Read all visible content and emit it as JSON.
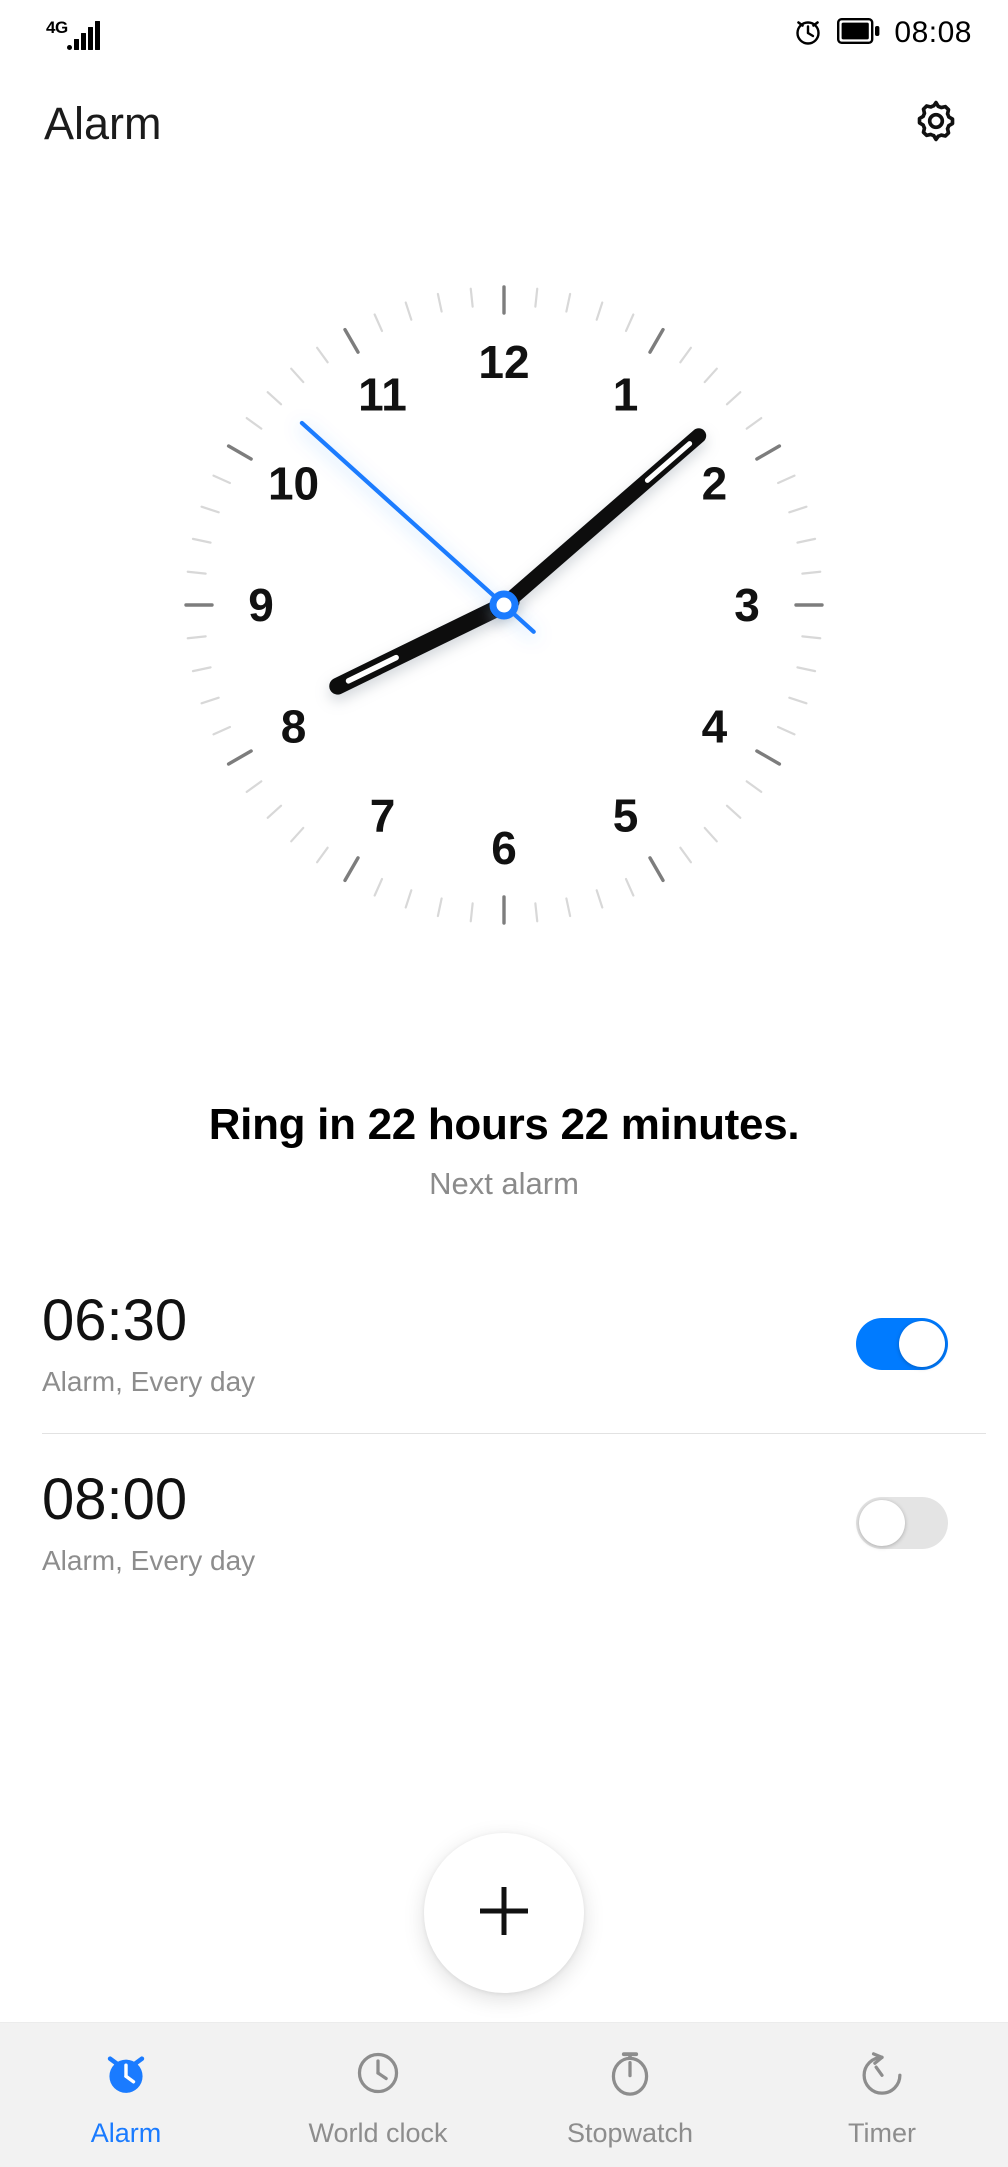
{
  "status_bar": {
    "network_label": "4G",
    "signal_icon": "signal-bars-icon",
    "alarm_icon": "alarm-clock-icon",
    "battery_icon": "battery-full-icon",
    "time": "08:08"
  },
  "app_bar": {
    "title": "Alarm",
    "settings_icon": "gear-icon"
  },
  "clock": {
    "numerals": [
      "1",
      "2",
      "3",
      "4",
      "5",
      "6",
      "7",
      "8",
      "9",
      "10",
      "11",
      "12"
    ],
    "hour_hand_angle": 244,
    "minute_hand_angle": 49,
    "second_hand_angle": 312,
    "hand_color": "#111111",
    "second_hand_color": "#1a7bff",
    "tick_color_minor": "#d8d8d8",
    "tick_color_major": "#7d7d7d",
    "numeral_color": "#111111"
  },
  "next_alarm": {
    "headline": "Ring in 22 hours 22 minutes.",
    "subtitle": "Next alarm"
  },
  "alarms": [
    {
      "time": "06:30",
      "description": "Alarm, Every day",
      "enabled": true,
      "toggle_on_color": "#007bff"
    },
    {
      "time": "08:00",
      "description": "Alarm, Every day",
      "enabled": false,
      "toggle_off_color": "#e4e4e4"
    }
  ],
  "fab": {
    "icon": "plus-icon",
    "label": "Add alarm"
  },
  "bottom_nav": {
    "active_color": "#1a7bff",
    "inactive_color": "#8d8d8d",
    "items": [
      {
        "label": "Alarm",
        "icon": "alarm-clock-icon",
        "active": true
      },
      {
        "label": "World clock",
        "icon": "clock-icon",
        "active": false
      },
      {
        "label": "Stopwatch",
        "icon": "stopwatch-icon",
        "active": false
      },
      {
        "label": "Timer",
        "icon": "timer-icon",
        "active": false
      }
    ]
  }
}
